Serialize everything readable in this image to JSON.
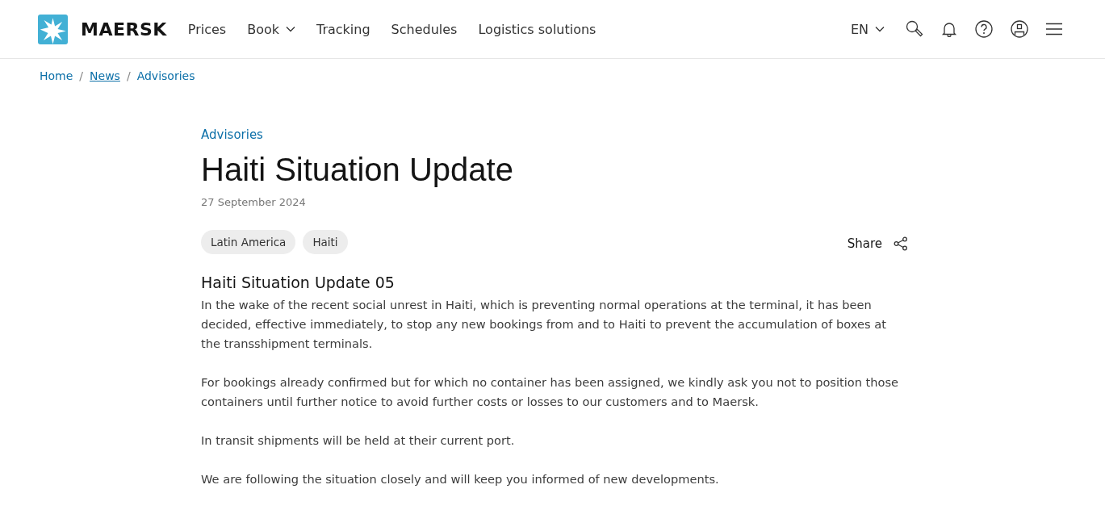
{
  "header": {
    "logo_text": "MAERSK",
    "nav": [
      {
        "label": "Prices",
        "dropdown": false
      },
      {
        "label": "Book",
        "dropdown": true
      },
      {
        "label": "Tracking",
        "dropdown": false
      },
      {
        "label": "Schedules",
        "dropdown": false
      },
      {
        "label": "Logistics solutions",
        "dropdown": false
      }
    ],
    "language": "EN"
  },
  "breadcrumb_separator": "/",
  "breadcrumb": [
    {
      "label": "Home",
      "kind": "link"
    },
    {
      "label": "News",
      "kind": "underlined"
    },
    {
      "label": "Advisories",
      "kind": "link"
    }
  ],
  "article": {
    "category": "Advisories",
    "title": "Haiti Situation Update",
    "date": "27 September 2024",
    "tags": [
      "Latin America",
      "Haiti"
    ],
    "share": "Share",
    "subtitle": "Haiti Situation Update 05",
    "paragraphs": [
      "In the wake of the recent social unrest in Haiti, which is preventing normal operations at the terminal, it has been decided, effective immediately, to stop any new bookings from and to Haiti to prevent the accumulation of boxes at the transshipment terminals.",
      "For bookings already confirmed but for which no container has been assigned, we kindly ask you not to position those containers until further notice to avoid further costs or losses to our customers and to Maersk.",
      "In transit shipments will be held at their current port.",
      "We are following the situation closely and will keep you informed of new developments."
    ]
  }
}
